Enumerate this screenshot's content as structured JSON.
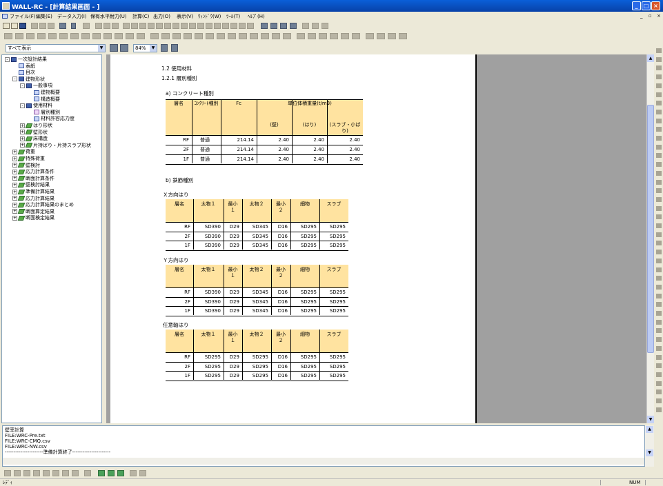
{
  "window": {
    "title": "WALL-RC - [計算結果画面 - ]"
  },
  "menu": [
    "ファイル(F)",
    "編集(E)",
    "データ入力(I)",
    "保有水平耐力(U)",
    "計算(C)",
    "出力(O)",
    "表示(V)",
    "ｳｨﾝﾄﾞｳ(W)",
    "ﾂｰﾙ(T)",
    "ﾍﾙﾌﾟ(H)"
  ],
  "toolbar": {
    "view_select": "すべて表示",
    "zoom": "84%"
  },
  "tree": [
    {
      "label": "一次設計結果",
      "level": 0,
      "icon": "book",
      "exp": "−"
    },
    {
      "label": "表紙",
      "level": 1,
      "icon": "doc"
    },
    {
      "label": "目次",
      "level": 1,
      "icon": "doc"
    },
    {
      "label": "建物形状",
      "level": 1,
      "icon": "book",
      "exp": "−"
    },
    {
      "label": "一般事項",
      "level": 2,
      "icon": "book",
      "exp": "−"
    },
    {
      "label": "建物概要",
      "level": 3,
      "icon": "doc"
    },
    {
      "label": "構造概要",
      "level": 3,
      "icon": "doc"
    },
    {
      "label": "使用材料",
      "level": 2,
      "icon": "book",
      "exp": "−"
    },
    {
      "label": "層別種別",
      "level": 3,
      "icon": "docp"
    },
    {
      "label": "材料許容応力度",
      "level": 3,
      "icon": "doc"
    },
    {
      "label": "はり形状",
      "level": 2,
      "icon": "fold",
      "exp": "+"
    },
    {
      "label": "壁形状",
      "level": 2,
      "icon": "fold",
      "exp": "+"
    },
    {
      "label": "床構造",
      "level": 2,
      "icon": "fold",
      "exp": "+"
    },
    {
      "label": "片持ばり・片持スラブ形状",
      "level": 2,
      "icon": "fold",
      "exp": "+"
    },
    {
      "label": "荷重",
      "level": 1,
      "icon": "fold",
      "exp": "+"
    },
    {
      "label": "特殊荷重",
      "level": 1,
      "icon": "fold",
      "exp": "+"
    },
    {
      "label": "壁検討",
      "level": 1,
      "icon": "fold",
      "exp": "+"
    },
    {
      "label": "応力計算条件",
      "level": 1,
      "icon": "fold",
      "exp": "+"
    },
    {
      "label": "断面計算条件",
      "level": 1,
      "icon": "fold",
      "exp": "+"
    },
    {
      "label": "壁検討結果",
      "level": 1,
      "icon": "fold",
      "exp": "+"
    },
    {
      "label": "準備計算結果",
      "level": 1,
      "icon": "fold",
      "exp": "+"
    },
    {
      "label": "応力計算結果",
      "level": 1,
      "icon": "fold",
      "exp": "+"
    },
    {
      "label": "応力計算結果のまとめ",
      "level": 1,
      "icon": "fold",
      "exp": "+"
    },
    {
      "label": "断面算定結果",
      "level": 1,
      "icon": "fold",
      "exp": "+"
    },
    {
      "label": "断面検定結果",
      "level": 1,
      "icon": "fold",
      "exp": "+"
    }
  ],
  "doc": {
    "section": "1.2 使用材料",
    "subsection": "1.2.1 層別種別",
    "concrete": {
      "caption": "a) コンクリート種別",
      "h_floor": "層名",
      "h_type": "ｺﾝｸﾘｰﾄ種別",
      "h_fc": "Fc",
      "h_unit": "単位体積重量(t/m3)",
      "h_wall": "(壁)",
      "h_beam": "(はり)",
      "h_slab": "(スラブ・小ばり)",
      "rows": [
        {
          "floor": "RF",
          "type": "普通",
          "fc": "214.14",
          "wall": "2.40",
          "beam": "2.40",
          "slab": "2.40"
        },
        {
          "floor": "2F",
          "type": "普通",
          "fc": "214.14",
          "wall": "2.40",
          "beam": "2.40",
          "slab": "2.40"
        },
        {
          "floor": "1F",
          "type": "普通",
          "fc": "214.14",
          "wall": "2.40",
          "beam": "2.40",
          "slab": "2.40"
        }
      ]
    },
    "rebar": {
      "caption": "b) 鉄筋種別",
      "headers": [
        "層名",
        "太物１",
        "最小１",
        "太物２",
        "最小２",
        "細物",
        "スラブ"
      ],
      "tables": [
        {
          "title": "Ｘ方向はり",
          "rows": [
            [
              "RF",
              "SD390",
              "D29",
              "SD345",
              "D16",
              "SD295",
              "SD295"
            ],
            [
              "2F",
              "SD390",
              "D29",
              "SD345",
              "D16",
              "SD295",
              "SD295"
            ],
            [
              "1F",
              "SD390",
              "D29",
              "SD345",
              "D16",
              "SD295",
              "SD295"
            ]
          ]
        },
        {
          "title": "Ｙ方向はり",
          "rows": [
            [
              "RF",
              "SD390",
              "D29",
              "SD345",
              "D16",
              "SD295",
              "SD295"
            ],
            [
              "2F",
              "SD390",
              "D29",
              "SD345",
              "D16",
              "SD295",
              "SD295"
            ],
            [
              "1F",
              "SD390",
              "D29",
              "SD345",
              "D16",
              "SD295",
              "SD295"
            ]
          ]
        },
        {
          "title": "任意軸はり",
          "rows": [
            [
              "RF",
              "SD295",
              "D29",
              "SD295",
              "D16",
              "SD295",
              "SD295"
            ],
            [
              "2F",
              "SD295",
              "D29",
              "SD295",
              "D16",
              "SD295",
              "SD295"
            ],
            [
              "1F",
              "SD295",
              "D29",
              "SD295",
              "D16",
              "SD295",
              "SD295"
            ]
          ]
        }
      ]
    }
  },
  "output": {
    "lines": [
      "壁率計算",
      "FILE:WRC-Pre.txt",
      "FILE:WRC-CMQ.csv",
      "FILE:WRC-NW.csv",
      "----------------------準備計算終了----------------------"
    ]
  },
  "status": {
    "left": "ﾚﾃﾞｨ",
    "num": "NUM"
  }
}
